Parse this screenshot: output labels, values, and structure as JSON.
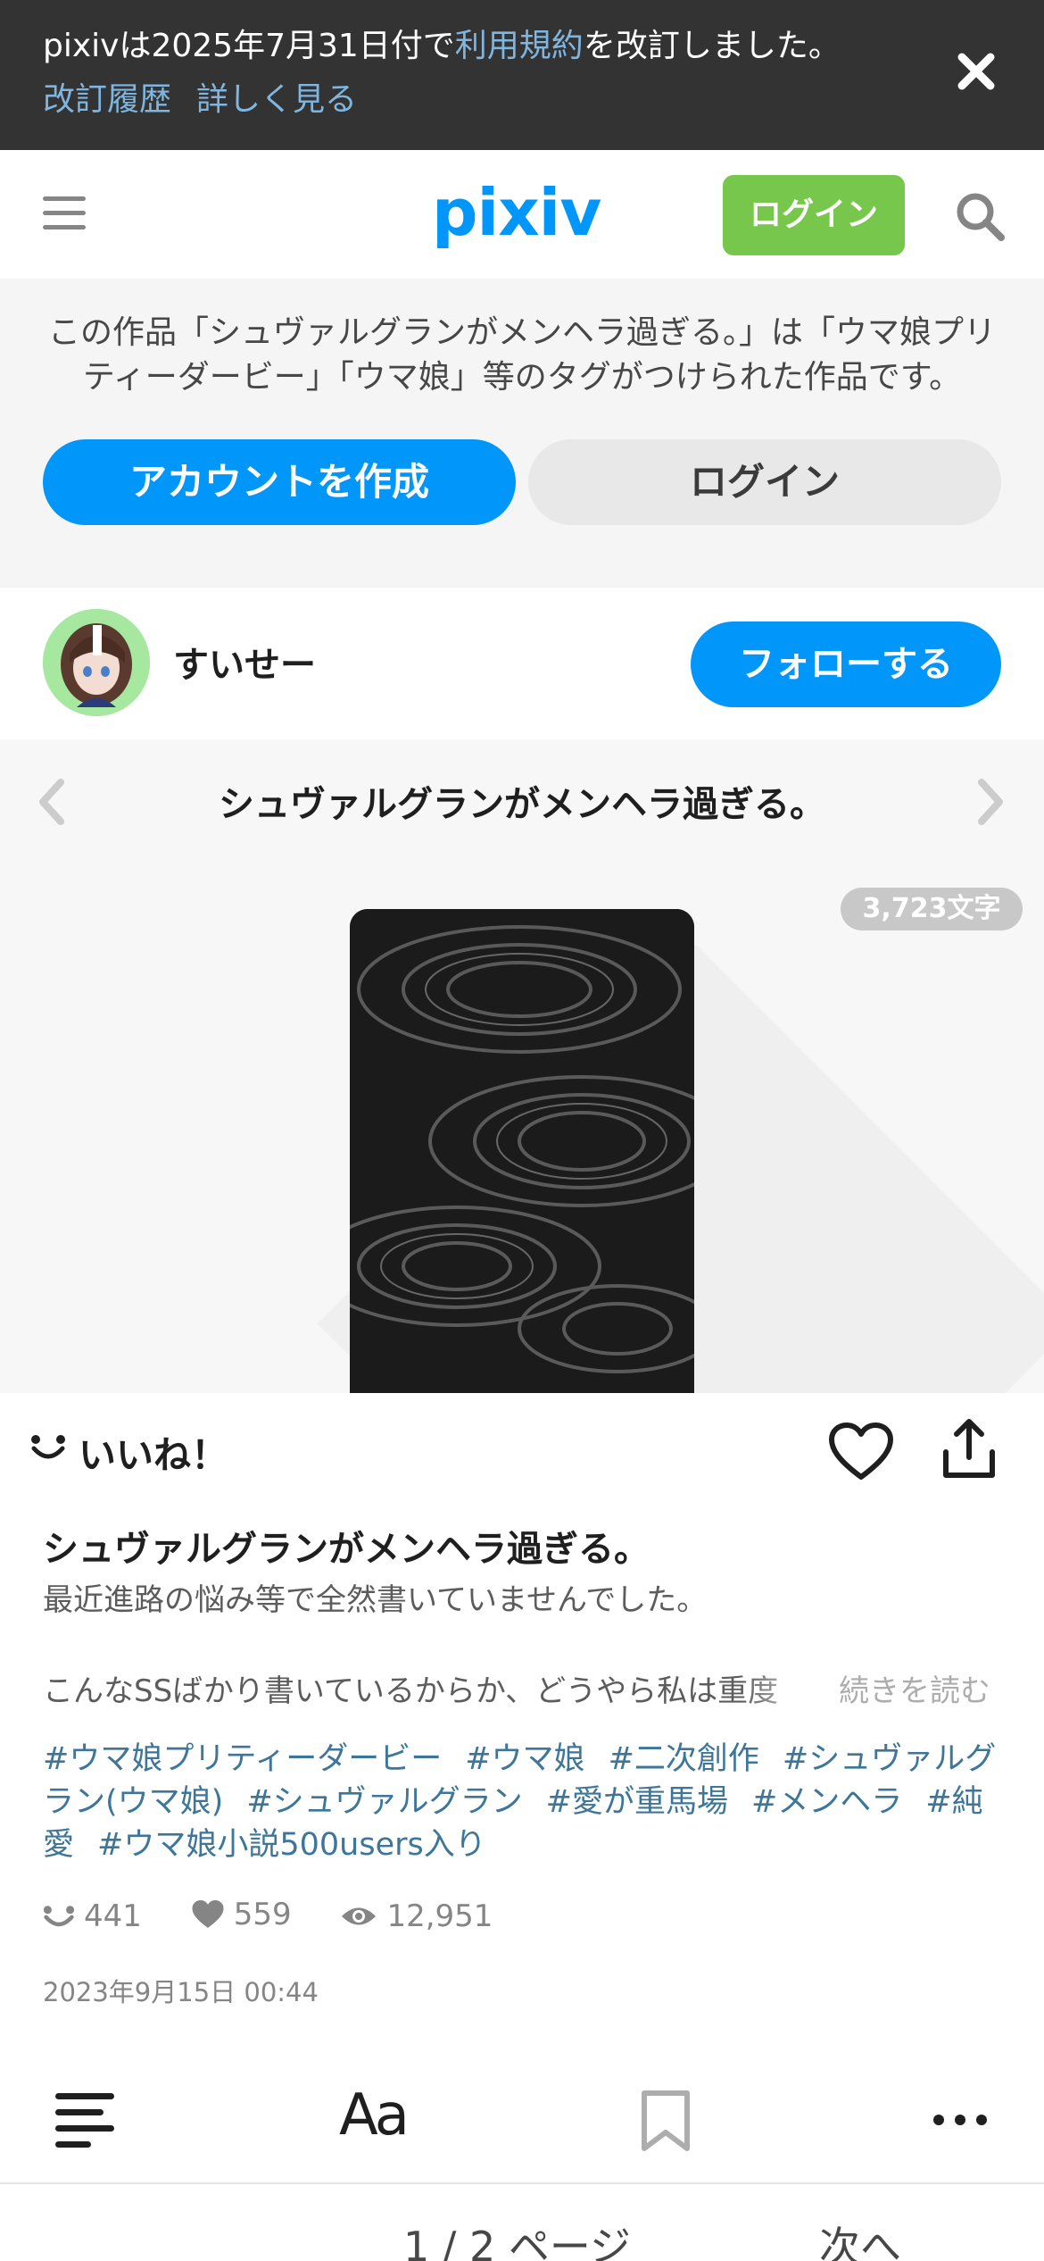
{
  "notice": {
    "text_before": "pixivは2025年7月31日付で",
    "text_link": "利用規約",
    "text_after": "を改訂しました。",
    "link_history": "改訂履歴",
    "link_details": "詳しく見る"
  },
  "header": {
    "logo": "pixiv",
    "login_label": "ログイン"
  },
  "info": {
    "text": "この作品「シュヴァルグランがメンヘラ過ぎる。」は「ウマ娘プリティーダービー」「ウマ娘」等のタグがつけられた作品です。",
    "create_account_label": "アカウントを作成",
    "login_label": "ログイン"
  },
  "user": {
    "name": "すいせー",
    "follow_label": "フォローする"
  },
  "work": {
    "title": "シュヴァルグランがメンヘラ過ぎる。",
    "char_count": "3,723文字",
    "like_label": "いいね！",
    "description_line1": "最近進路の悩み等で全然書いていませんでした。",
    "description_line2": "こんなSSばかり書いているからか、どうやら私は重度",
    "read_more": "続きを読む",
    "tags": [
      "#ウマ娘プリティーダービー",
      "#ウマ娘",
      "#二次創作",
      "#シュヴァルグラン(ウマ娘)",
      "#シュヴァルグラン",
      "#愛が重馬場",
      "#メンヘラ",
      "#純愛",
      "#ウマ娘小説500users入り"
    ],
    "stats": {
      "likes": "441",
      "bookmarks": "559",
      "views": "12,951"
    },
    "date": "2023年9月15日 00:44"
  },
  "toolbar": {
    "font_label": "Aa"
  },
  "pager": {
    "page_count": "1 / 2 ページ",
    "next_label": "次へ"
  },
  "colors": {
    "accent": "#0096fa",
    "login_green": "#76c74b",
    "banner_bg": "#333333",
    "tag": "#3d7699"
  }
}
